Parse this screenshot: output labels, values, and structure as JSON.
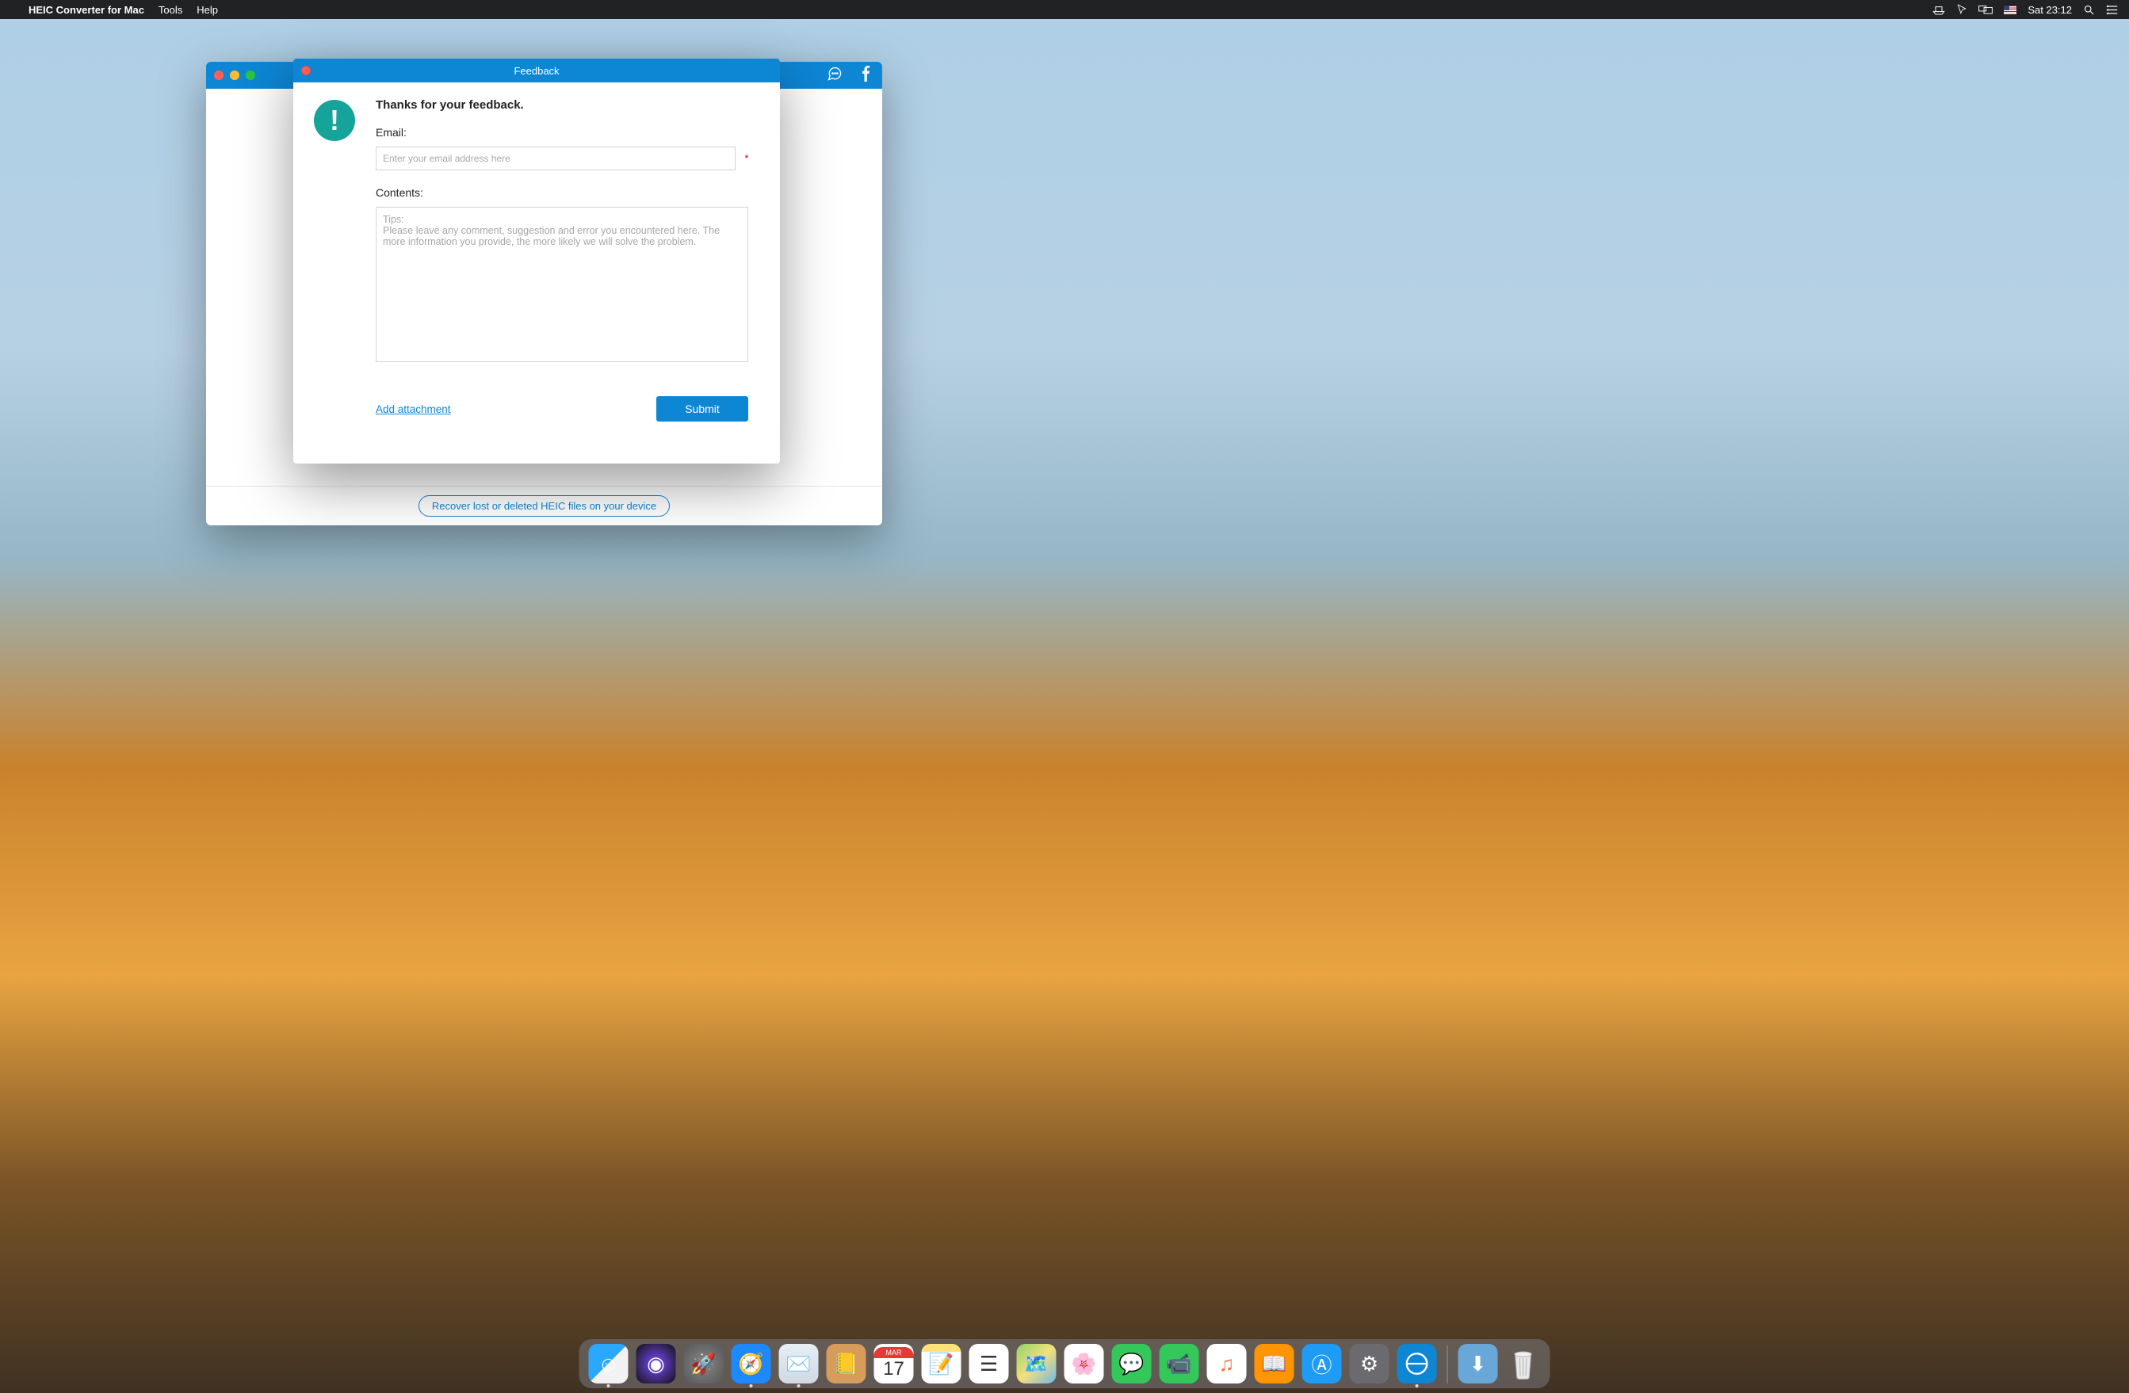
{
  "menubar": {
    "app_name": "HEIC Converter for Mac",
    "menus": [
      "Tools",
      "Help"
    ],
    "clock": "Sat 23:12"
  },
  "app_window": {
    "footer_link": "Recover lost or deleted HEIC files on your device"
  },
  "modal": {
    "title": "Feedback",
    "heading": "Thanks for your feedback.",
    "email_label": "Email:",
    "email_placeholder": "Enter your email address here",
    "required_mark": "*",
    "contents_label": "Contents:",
    "contents_placeholder": "Tips:\nPlease leave any comment, suggestion and error you encountered here. The more information you provide, the more likely we will solve the problem.",
    "add_attachment": "Add attachment",
    "submit": "Submit"
  },
  "dock": {
    "calendar_month": "MAR",
    "calendar_day": "17",
    "apps": [
      {
        "name": "finder",
        "running": true
      },
      {
        "name": "siri",
        "running": false
      },
      {
        "name": "launchpad",
        "running": false
      },
      {
        "name": "safari",
        "running": true
      },
      {
        "name": "mail",
        "running": true
      },
      {
        "name": "contacts",
        "running": false
      },
      {
        "name": "calendar",
        "running": false
      },
      {
        "name": "notes",
        "running": false
      },
      {
        "name": "reminders",
        "running": false
      },
      {
        "name": "maps",
        "running": false
      },
      {
        "name": "photos",
        "running": false
      },
      {
        "name": "messages",
        "running": false
      },
      {
        "name": "facetime",
        "running": false
      },
      {
        "name": "music",
        "running": false
      },
      {
        "name": "ibooks",
        "running": false
      },
      {
        "name": "appstore",
        "running": false
      },
      {
        "name": "settings",
        "running": false
      },
      {
        "name": "heic",
        "running": true
      }
    ]
  }
}
